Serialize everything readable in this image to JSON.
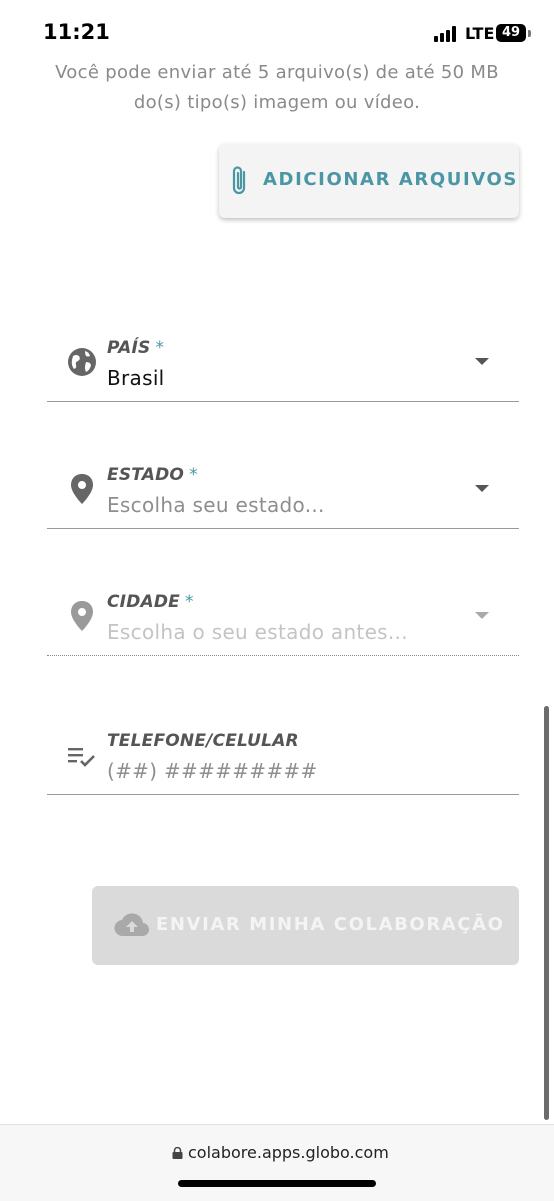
{
  "status_bar": {
    "time": "11:21",
    "network": "LTE",
    "battery": "49"
  },
  "upload": {
    "info_line1": "Você pode enviar até 5 arquivo(s) de até 50 MB",
    "info_line2": "do(s) tipo(s) imagem ou vídeo.",
    "add_files_label": "ADICIONAR ARQUIVOS"
  },
  "form": {
    "pais": {
      "label": "PAÍS",
      "required_mark": "*",
      "value": "Brasil",
      "icon": "globe-icon"
    },
    "estado": {
      "label": "ESTADO",
      "required_mark": "*",
      "placeholder": "Escolha seu estado...",
      "icon": "location-pin-icon"
    },
    "cidade": {
      "label": "CIDADE",
      "required_mark": "*",
      "placeholder": "Escolha o seu estado antes...",
      "icon": "location-pin-icon",
      "disabled": true
    },
    "telefone": {
      "label": "TELEFONE/CELULAR",
      "placeholder": "(##) #########",
      "icon": "list-check-icon"
    }
  },
  "submit": {
    "label": "ENVIAR MINHA COLABORAÇÃO",
    "icon": "cloud-upload-icon",
    "disabled": true
  },
  "browser": {
    "url": "colabore.apps.globo.com"
  },
  "colors": {
    "accent": "#4a96a5",
    "disabled_button": "#dadada",
    "label_gray": "#555555"
  }
}
